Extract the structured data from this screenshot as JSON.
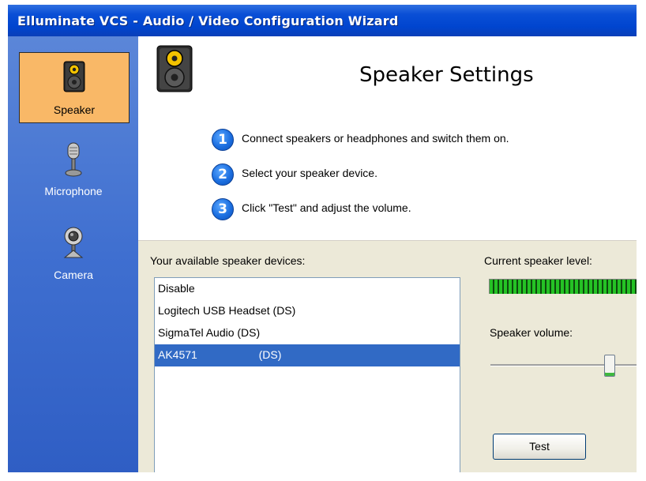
{
  "window": {
    "title": "Elluminate VCS - Audio / Video Configuration Wizard"
  },
  "sidebar": {
    "items": [
      {
        "label": "Speaker",
        "icon": "speaker-icon",
        "selected": true
      },
      {
        "label": "Microphone",
        "icon": "microphone-icon",
        "selected": false
      },
      {
        "label": "Camera",
        "icon": "webcam-icon",
        "selected": false
      }
    ]
  },
  "main": {
    "title": "Speaker Settings",
    "icon": "speaker-icon",
    "steps": [
      {
        "number": "1",
        "text": "Connect speakers or headphones and switch them on."
      },
      {
        "number": "2",
        "text": "Select your speaker device."
      },
      {
        "number": "3",
        "text": "Click \"Test\" and adjust the volume."
      }
    ]
  },
  "devices": {
    "label": "Your available speaker devices:",
    "items": [
      {
        "label": "Disable",
        "selected": false
      },
      {
        "label": "Logitech USB Headset (DS)",
        "selected": false
      },
      {
        "label": "SigmaTel Audio (DS)",
        "selected": false
      },
      {
        "label": "AK4571                    (DS)",
        "selected": true
      }
    ]
  },
  "level": {
    "label": "Current speaker level:",
    "value_fraction": 1.0
  },
  "volume": {
    "label": "Speaker volume:",
    "value_fraction": 0.84
  },
  "test_button": {
    "label": "Test"
  },
  "colors": {
    "title_bar": "#0045cf",
    "sidebar": "#3f6fd0",
    "selected_nav": "#f9b867",
    "selected_item": "#316ac5",
    "meter": "#25c225"
  }
}
